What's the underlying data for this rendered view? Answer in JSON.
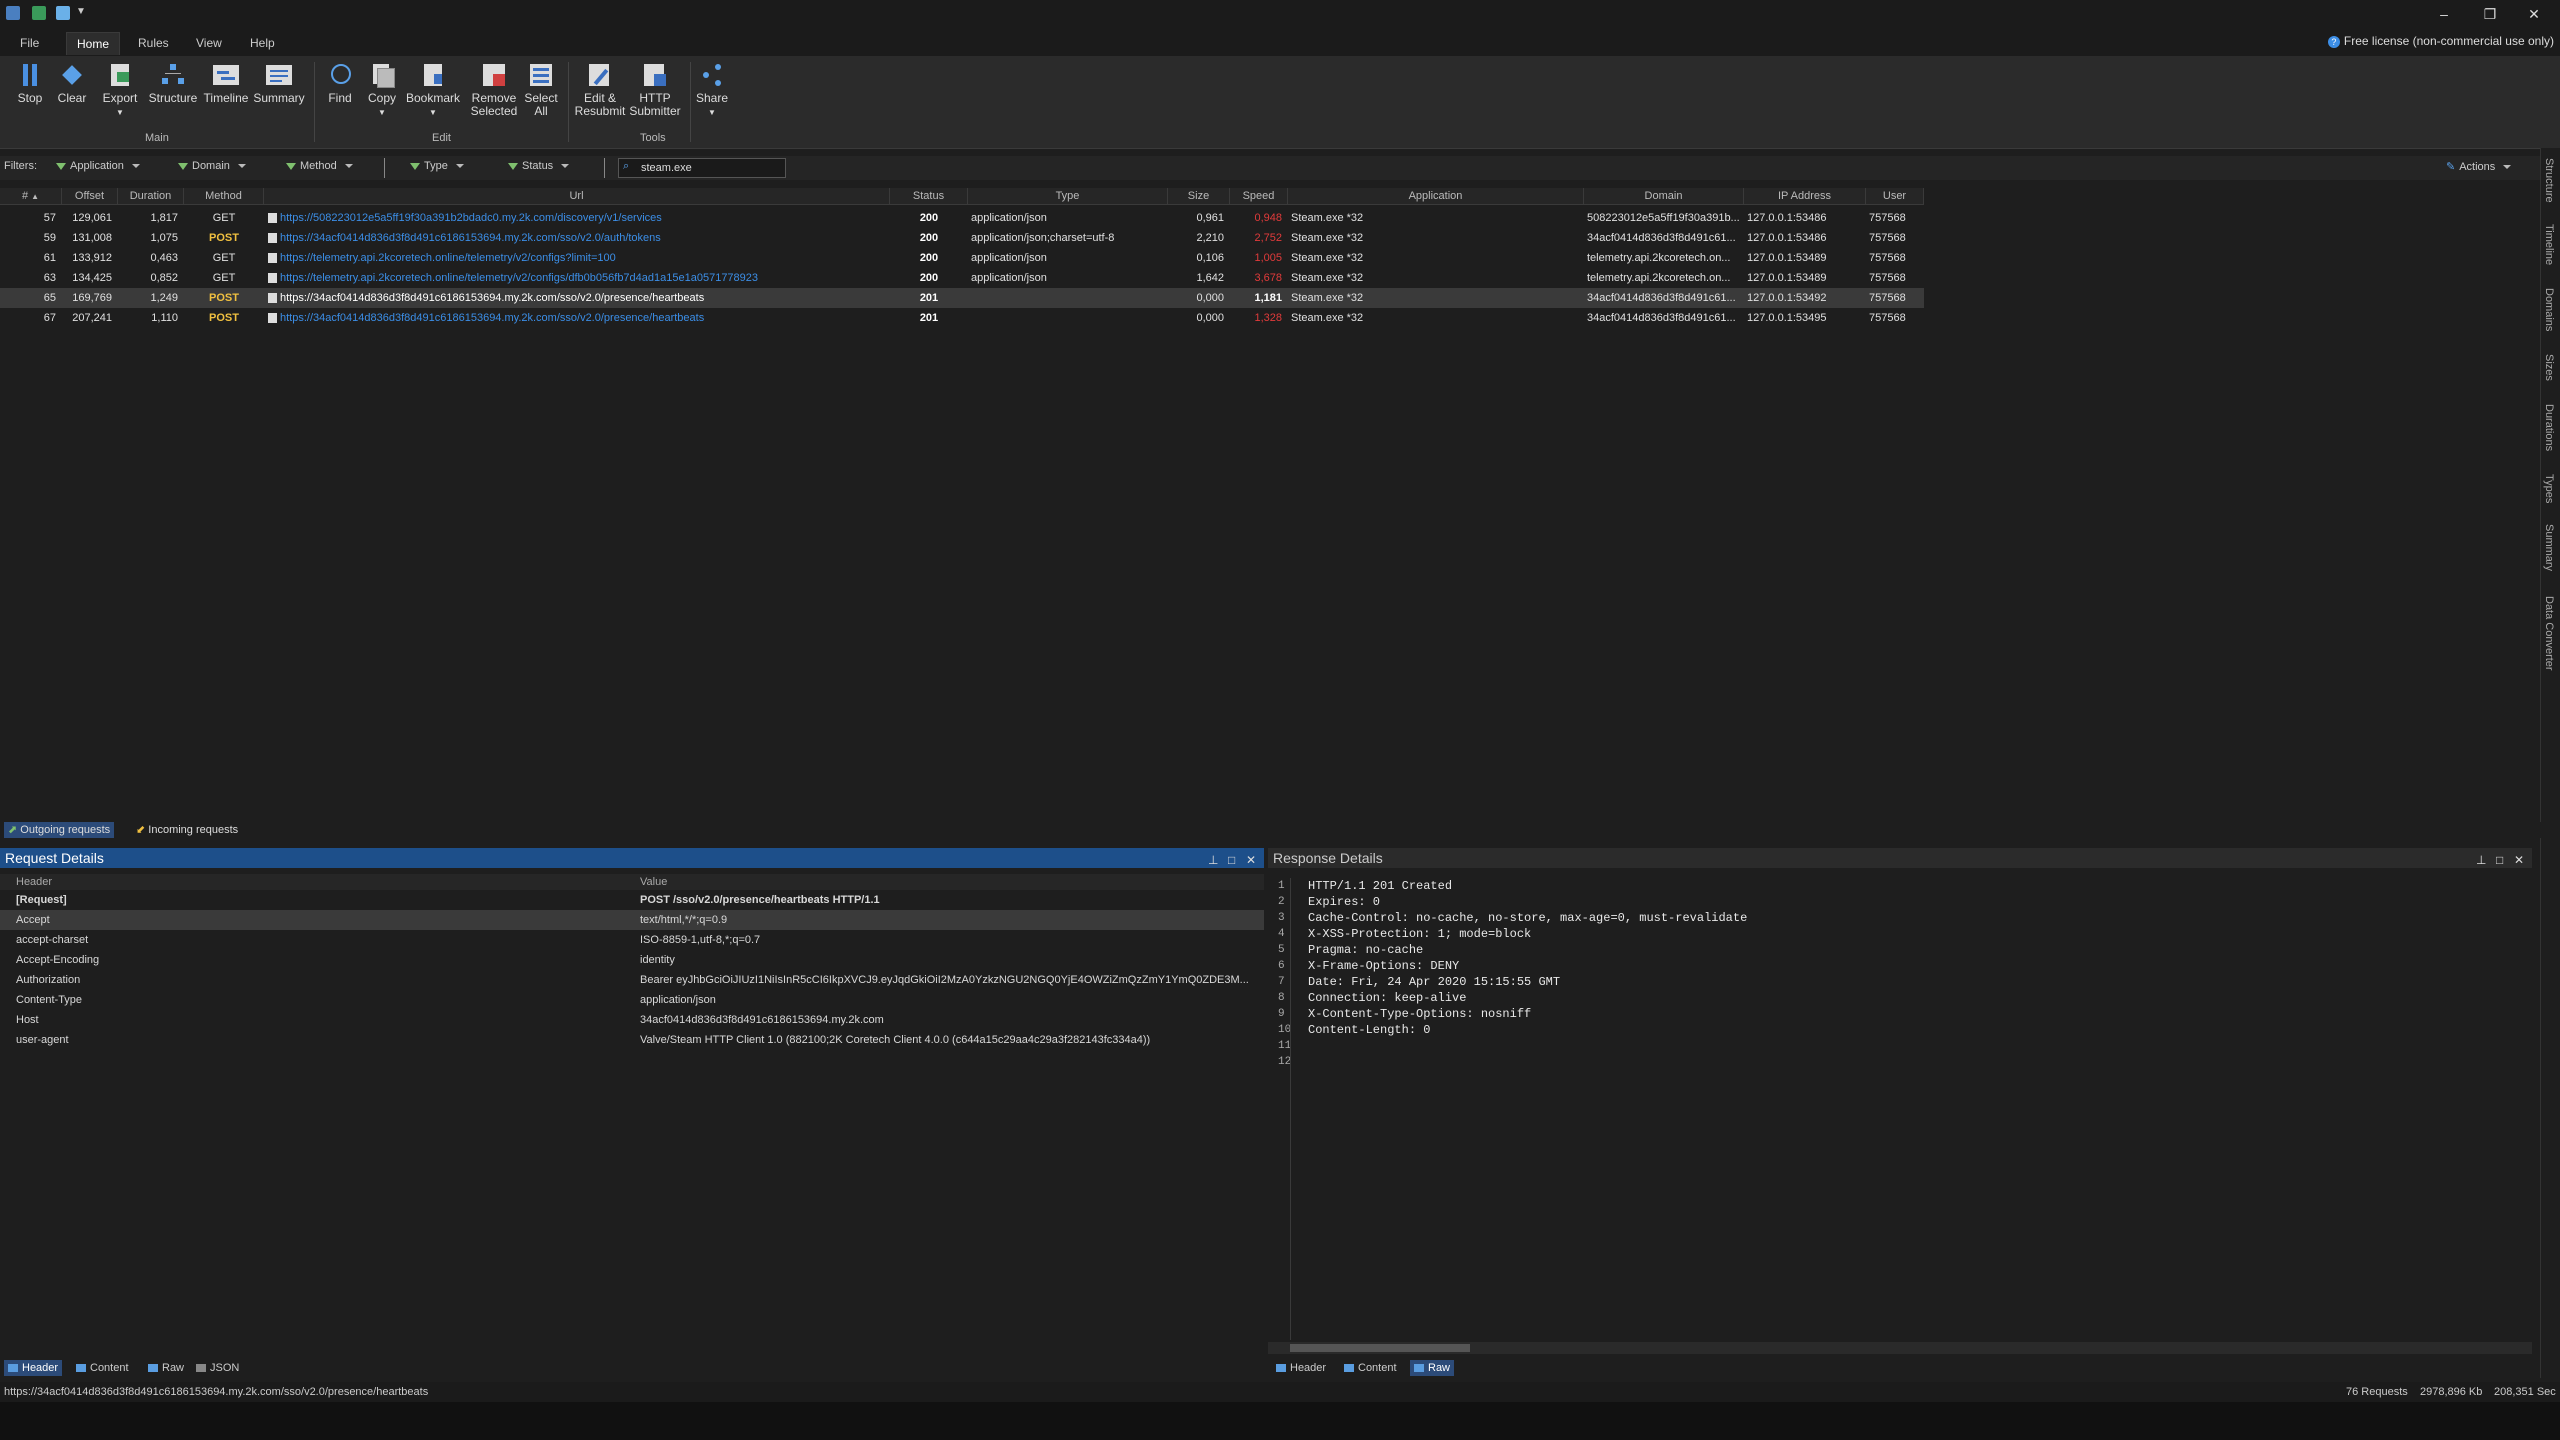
{
  "menu": {
    "items": [
      "File",
      "Home",
      "Rules",
      "View",
      "Help"
    ],
    "active": "Home",
    "license": "Free license (non-commercial use only)"
  },
  "ribbon": {
    "main_buttons": [
      "Stop",
      "Clear",
      "Export",
      "Structure",
      "Timeline",
      "Summary"
    ],
    "main_label": "Main",
    "edit_buttons": {
      "find": "Find",
      "copy": "Copy",
      "bookmark": "Bookmark",
      "remove1": "Remove",
      "remove2": "Selected",
      "selectall1": "Select",
      "selectall2": "All"
    },
    "edit_label": "Edit",
    "tools_buttons": {
      "resubmit1": "Edit &",
      "resubmit2": "Resubmit",
      "http1": "HTTP",
      "http2": "Submitter"
    },
    "tools_label": "Tools",
    "share": "Share"
  },
  "filters": {
    "label": "Filters:",
    "items": [
      "Application",
      "Domain",
      "Method",
      "Type",
      "Status"
    ],
    "search_value": "steam.exe",
    "actions": "Actions"
  },
  "grid": {
    "columns": [
      "#",
      "Offset",
      "Duration",
      "Method",
      "Url",
      "Status",
      "Type",
      "Size",
      "Speed",
      "Application",
      "Domain",
      "IP Address",
      "User"
    ],
    "rows": [
      {
        "id": "57",
        "offset": "129,061",
        "duration": "1,817",
        "method": "GET",
        "url": "https://508223012e5a5ff19f30a391b2bdadc0.my.2k.com/discovery/v1/services",
        "status": "200",
        "type": "application/json",
        "size": "0,961",
        "speed": "0,948",
        "app": "Steam.exe *32",
        "domain": "508223012e5a5ff19f30a391b...",
        "ip": "127.0.0.1:53486",
        "user": "757568"
      },
      {
        "id": "59",
        "offset": "131,008",
        "duration": "1,075",
        "method": "POST",
        "url": "https://34acf0414d836d3f8d491c6186153694.my.2k.com/sso/v2.0/auth/tokens",
        "status": "200",
        "type": "application/json;charset=utf-8",
        "size": "2,210",
        "speed": "2,752",
        "app": "Steam.exe *32",
        "domain": "34acf0414d836d3f8d491c61...",
        "ip": "127.0.0.1:53486",
        "user": "757568"
      },
      {
        "id": "61",
        "offset": "133,912",
        "duration": "0,463",
        "method": "GET",
        "url": "https://telemetry.api.2kcoretech.online/telemetry/v2/configs?limit=100",
        "status": "200",
        "type": "application/json",
        "size": "0,106",
        "speed": "1,005",
        "app": "Steam.exe *32",
        "domain": "telemetry.api.2kcoretech.on...",
        "ip": "127.0.0.1:53489",
        "user": "757568"
      },
      {
        "id": "63",
        "offset": "134,425",
        "duration": "0,852",
        "method": "GET",
        "url": "https://telemetry.api.2kcoretech.online/telemetry/v2/configs/dfb0b056fb7d4ad1a15e1a0571778923",
        "status": "200",
        "type": "application/json",
        "size": "1,642",
        "speed": "3,678",
        "app": "Steam.exe *32",
        "domain": "telemetry.api.2kcoretech.on...",
        "ip": "127.0.0.1:53489",
        "user": "757568"
      },
      {
        "id": "65",
        "offset": "169,769",
        "duration": "1,249",
        "method": "POST",
        "url": "https://34acf0414d836d3f8d491c6186153694.my.2k.com/sso/v2.0/presence/heartbeats",
        "status": "201",
        "type": "",
        "size": "0,000",
        "speed": "1,181",
        "app": "Steam.exe *32",
        "domain": "34acf0414d836d3f8d491c61...",
        "ip": "127.0.0.1:53492",
        "user": "757568"
      },
      {
        "id": "67",
        "offset": "207,241",
        "duration": "1,110",
        "method": "POST",
        "url": "https://34acf0414d836d3f8d491c6186153694.my.2k.com/sso/v2.0/presence/heartbeats",
        "status": "201",
        "type": "",
        "size": "0,000",
        "speed": "1,328",
        "app": "Steam.exe *32",
        "domain": "34acf0414d836d3f8d491c61...",
        "ip": "127.0.0.1:53495",
        "user": "757568"
      }
    ],
    "selected_row": 4
  },
  "side_tabs": [
    "Structure",
    "Timeline",
    "Domains",
    "Sizes",
    "Durations",
    "Types",
    "Summary",
    "Data Converter"
  ],
  "request_tabs": {
    "outgoing": "Outgoing requests",
    "incoming": "Incoming requests"
  },
  "request_details": {
    "title": "Request Details",
    "col_header": "Header",
    "col_value": "Value",
    "rows": [
      {
        "k": "[Request]",
        "v": "POST /sso/v2.0/presence/heartbeats HTTP/1.1"
      },
      {
        "k": "Accept",
        "v": "text/html,*/*;q=0.9"
      },
      {
        "k": "accept-charset",
        "v": "ISO-8859-1,utf-8,*;q=0.7"
      },
      {
        "k": "Accept-Encoding",
        "v": "identity"
      },
      {
        "k": "Authorization",
        "v": "Bearer eyJhbGciOiJIUzI1NiIsInR5cCI6IkpXVCJ9.eyJqdGkiOiI2MzA0YzkzNGU2NGQ0YjE4OWZiZmQzZmY1YmQ0ZDE3M..."
      },
      {
        "k": "Content-Type",
        "v": "application/json"
      },
      {
        "k": "Host",
        "v": "34acf0414d836d3f8d491c6186153694.my.2k.com"
      },
      {
        "k": "user-agent",
        "v": "Valve/Steam HTTP Client 1.0 (882100;2K Coretech Client 4.0.0 (c644a15c29aa4c29a3f282143fc334a4))"
      }
    ],
    "bottom_tabs": [
      "Header",
      "Content",
      "Raw",
      "JSON"
    ]
  },
  "response_details": {
    "title": "Response Details",
    "lines": [
      "HTTP/1.1 201 Created",
      "Expires: 0",
      "Cache-Control: no-cache, no-store, max-age=0, must-revalidate",
      "X-XSS-Protection: 1; mode=block",
      "Pragma: no-cache",
      "X-Frame-Options: DENY",
      "Date: Fri, 24 Apr 2020 15:15:55 GMT",
      "Connection: keep-alive",
      "X-Content-Type-Options: nosniff",
      "Content-Length: 0",
      "",
      ""
    ],
    "bottom_tabs": [
      "Header",
      "Content",
      "Raw"
    ]
  },
  "statusbar": {
    "url": "https://34acf0414d836d3f8d491c6186153694.my.2k.com/sso/v2.0/presence/heartbeats",
    "requests": "76 Requests",
    "kb": "2978,896 Kb",
    "sec": "208,351 Sec"
  }
}
